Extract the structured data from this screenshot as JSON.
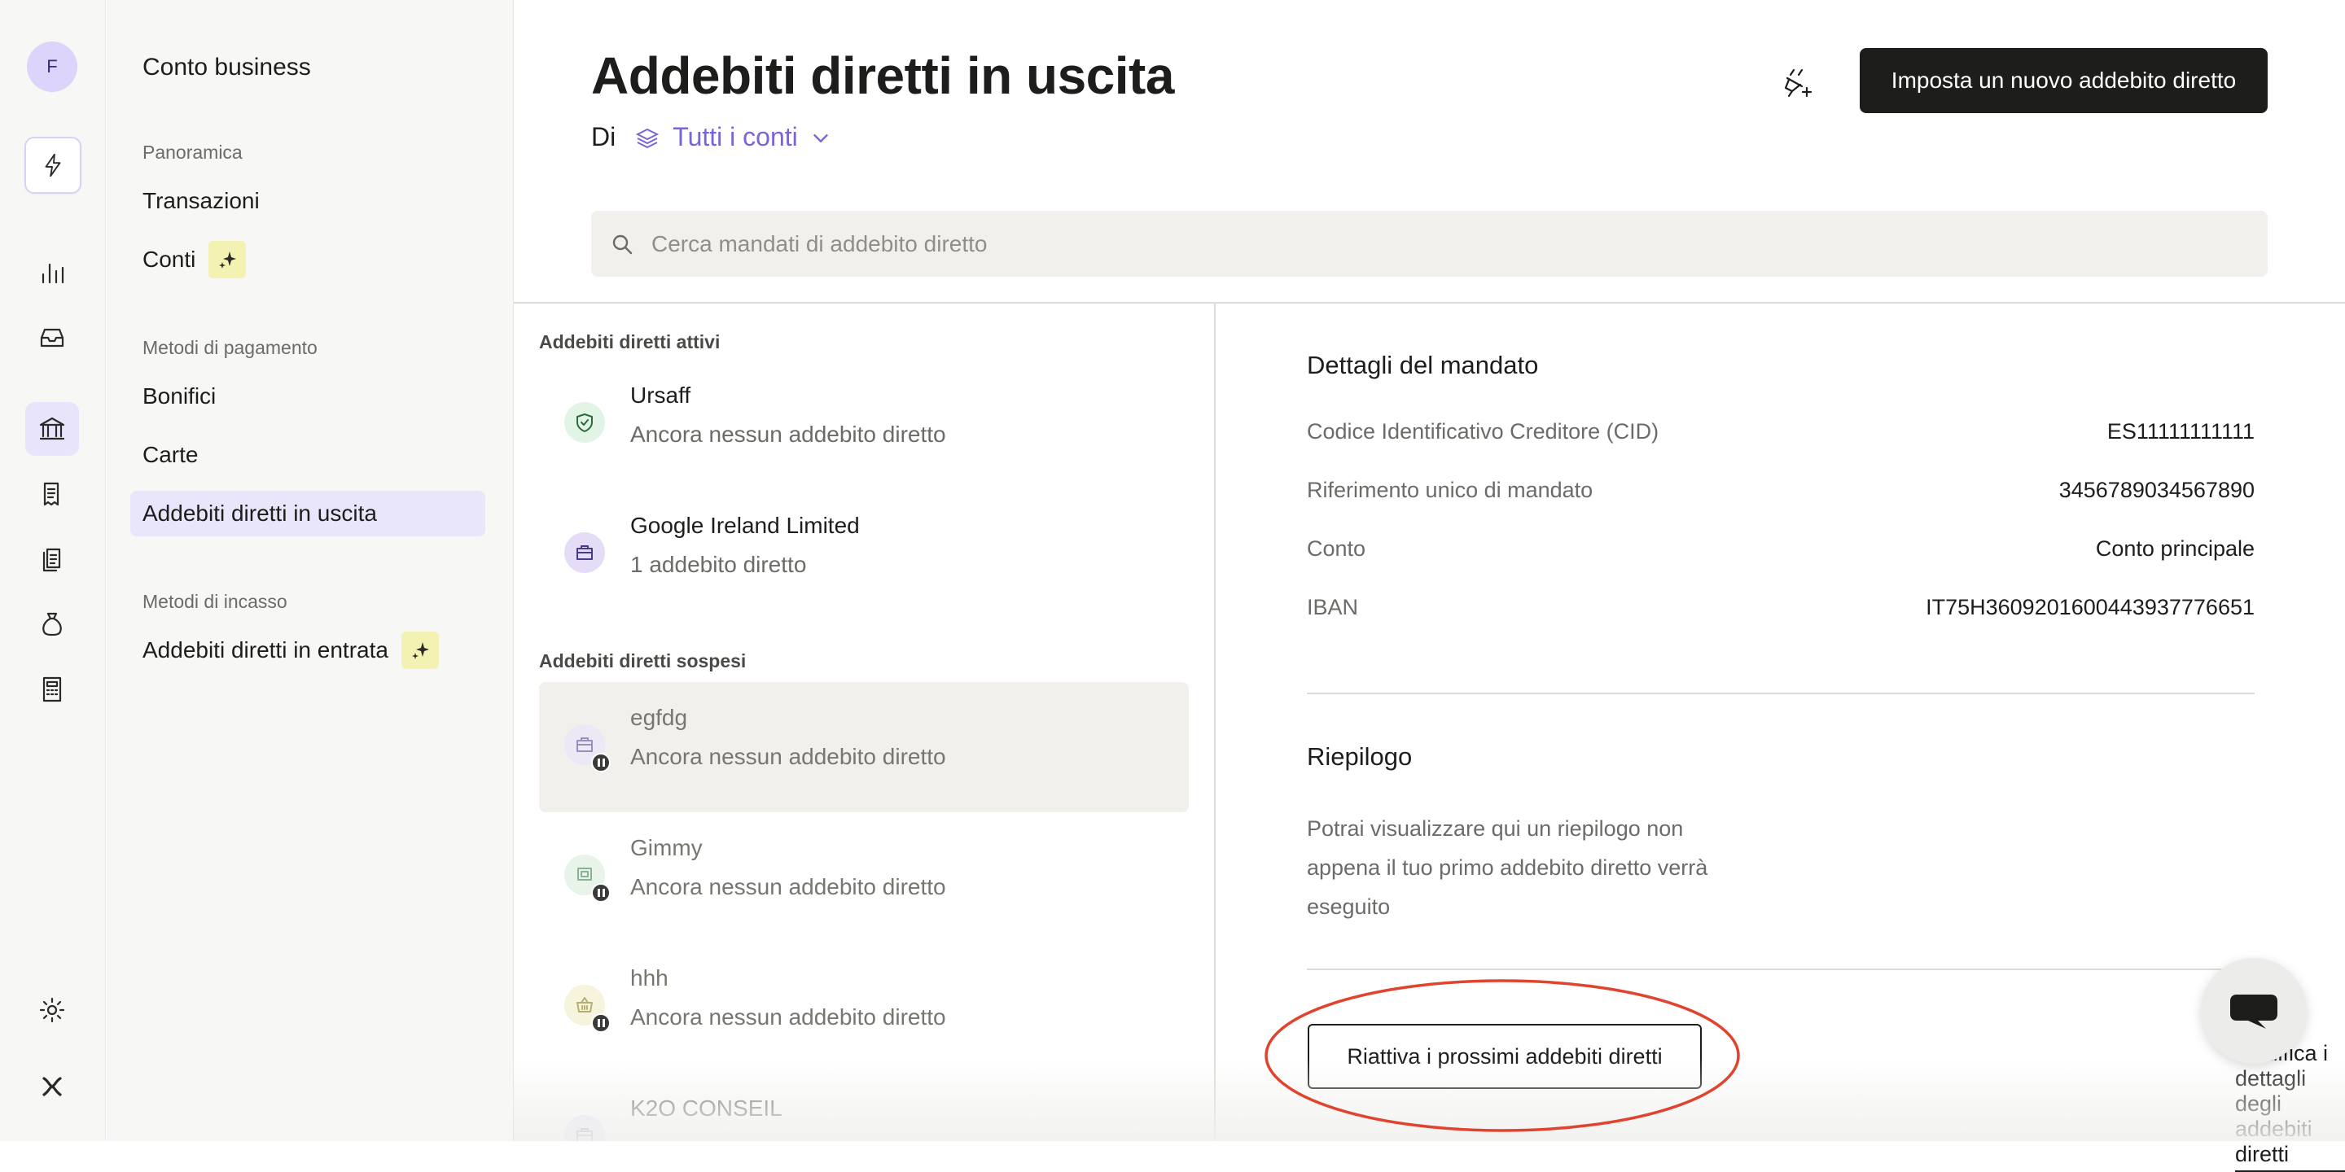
{
  "rail": {
    "avatar_letter": "F",
    "icons": [
      "bolt-icon",
      "bar-chart-icon",
      "inbox-icon",
      "bank-icon",
      "receipt-icon",
      "documents-icon",
      "money-bag-icon",
      "calculator-icon",
      "gear-icon",
      "logo-icon"
    ]
  },
  "nav": {
    "title": "Conto business",
    "group1": "Panoramica",
    "transazioni": "Transazioni",
    "conti": "Conti",
    "group2": "Metodi di pagamento",
    "bonifici": "Bonifici",
    "carte": "Carte",
    "addebiti_uscita": "Addebiti diretti in uscita",
    "group3": "Metodi di incasso",
    "addebiti_entrata": "Addebiti diretti in entrata"
  },
  "header": {
    "title": "Addebiti diretti in uscita",
    "di": "Di",
    "account_filter": "Tutti i conti",
    "new_button": "Imposta un nuovo addebito diretto",
    "search_placeholder": "Cerca mandati di addebito diretto"
  },
  "list": {
    "active_heading": "Addebiti diretti attivi",
    "suspended_heading": "Addebiti diretti sospesi",
    "active": [
      {
        "name": "Ursaff",
        "sub": "Ancora nessun addebito diretto",
        "icon": "shield-icon"
      },
      {
        "name": "Google Ireland Limited",
        "sub": "1 addebito diretto",
        "icon": "briefcase-icon"
      }
    ],
    "suspended": [
      {
        "name": "egfdg",
        "sub": "Ancora nessun addebito diretto",
        "icon": "briefcase-icon"
      },
      {
        "name": "Gimmy",
        "sub": "Ancora nessun addebito diretto",
        "icon": "screen-icon"
      },
      {
        "name": "hhh",
        "sub": "Ancora nessun addebito diretto",
        "icon": "basket-icon"
      },
      {
        "name": "K2O CONSEIL",
        "sub": "",
        "icon": "briefcase-icon"
      }
    ]
  },
  "detail": {
    "mandate_heading": "Dettagli del mandato",
    "rows": [
      {
        "k": "Codice Identificativo Creditore (CID)",
        "v": "ES11111111111"
      },
      {
        "k": "Riferimento unico di mandato",
        "v": "3456789034567890"
      },
      {
        "k": "Conto",
        "v": "Conto principale"
      },
      {
        "k": "IBAN",
        "v": "IT75H3609201600443937776651"
      }
    ],
    "summary_heading": "Riepilogo",
    "summary_text": "Potrai visualizzare qui un riepilogo non appena il tuo primo addebito diretto verrà eseguito",
    "reactivate_button": "Riattiva i prossimi addebiti diretti",
    "edit_link": "Modifica i dettagli degli addebiti diretti"
  },
  "colors": {
    "accent": "#7b63d8",
    "dark_button": "#1d1d1b",
    "annotation": "#e0442e"
  }
}
